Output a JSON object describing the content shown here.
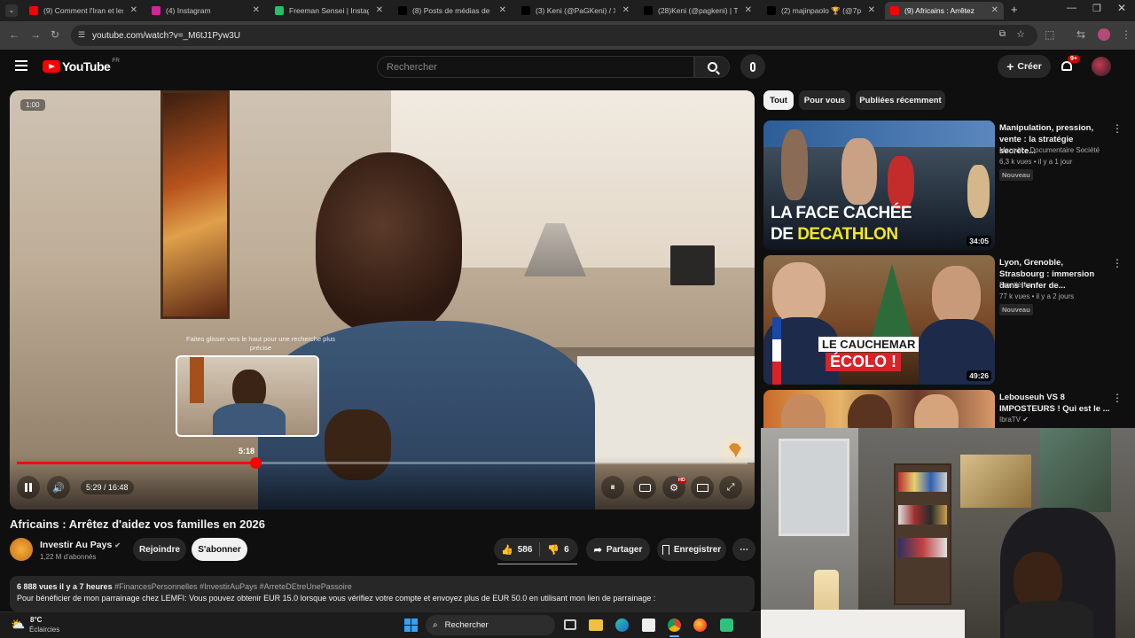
{
  "browser": {
    "tabs": [
      {
        "title": "(9) Comment l'Iran et les",
        "icon": "youtube-icon",
        "color": "#ff0000"
      },
      {
        "title": "(4) Instagram",
        "icon": "instagram-icon",
        "color": "#d6249f"
      },
      {
        "title": "Freeman Sensei | Instagra",
        "icon": "green-app-icon",
        "color": "#23c16b"
      },
      {
        "title": "(8) Posts de médias de Bl",
        "icon": "x-icon",
        "color": "#000000"
      },
      {
        "title": "(3) Keni (@PaGKeni) / X",
        "icon": "x-icon",
        "color": "#000000"
      },
      {
        "title": "(28)Keni (@pagkeni) | Tik",
        "icon": "tiktok-icon",
        "color": "#000000"
      },
      {
        "title": "(2) majinpaolo 🏆 (@7p",
        "icon": "x-icon",
        "color": "#000000"
      },
      {
        "title": "(9) Africains : Arrêtez",
        "icon": "youtube-icon",
        "color": "#ff0000"
      }
    ],
    "url": "youtube.com/watch?v=_M6tJ1Pyw3U"
  },
  "header": {
    "logo_text": "YouTube",
    "logo_region": "FR",
    "search_placeholder": "Rechercher",
    "create_label": "Créer",
    "notif_count": "9+"
  },
  "player": {
    "speed_badge": "1:00",
    "hint_text": "Faites glisser vers le haut pour une recherche plus précise",
    "preview_time": "5:18",
    "time_display": "5:29 / 16:48",
    "progress": 0.3264,
    "hd_badge": "HD"
  },
  "video": {
    "title": "Africains : Arrêtez d'aidez vos familles en 2026",
    "channel": "Investir Au Pays",
    "subs": "1,22 M d'abonnés",
    "join_label": "Rejoindre",
    "subscribe_label": "S'abonner",
    "likes": "586",
    "dislikes": "6",
    "share_label": "Partager",
    "save_label": "Enregistrer",
    "desc_meta": "6 888 vues  il y a 7 heures",
    "desc_tags": "#FinancesPersonnelles #InvestirAuPays #ArreteDEtreUnePassoire",
    "desc_text": "Pour bénéficier de mon parrainage chez LEMFI: Vous pouvez obtenir EUR 15.0 lorsque vous vérifiez votre compte et envoyez plus de EUR 50.0 en utilisant mon lien de parrainage :"
  },
  "sidebar": {
    "chips": [
      "Tout",
      "Pour vous",
      "Publiées récemment"
    ],
    "videos": [
      {
        "title": "Manipulation, pression, vente : la stratégie secrète...",
        "channel": "Marqué • Documentaire Société",
        "meta": "6,3 k vues • il y a 1 jour",
        "badge": "Nouveau",
        "duration": "34:05",
        "thumb_line1": "LA FACE CACHÉE",
        "thumb_line2a": "DE ",
        "thumb_line2b": "DECATHLON"
      },
      {
        "title": "Lyon, Grenoble, Strasbourg : immersion dans l'enfer de...",
        "channel": "Frontières",
        "meta": "77 k vues • il y a 2 jours",
        "badge": "Nouveau",
        "duration": "49:26",
        "thumb_line1": "LE CAUCHEMAR",
        "thumb_line2a": "ÉCOLO !",
        "thumb_line2b": ""
      },
      {
        "title": "Lebouseuh VS 8 IMPOSTEURS ! Qui est le ...",
        "channel": "IbraTV",
        "meta": "",
        "badge": "",
        "duration": "",
        "thumb_line1": "",
        "thumb_line2a": "",
        "thumb_line2b": ""
      }
    ]
  },
  "taskbar": {
    "weather_temp": "8°C",
    "weather_desc": "Éclaircies",
    "search_label": "Rechercher"
  }
}
